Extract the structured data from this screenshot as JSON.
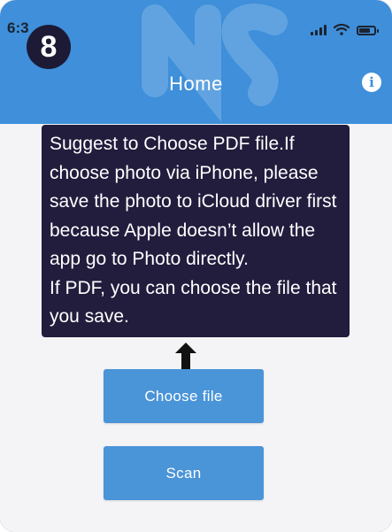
{
  "status_bar": {
    "time": "6:3",
    "icons": [
      "signal-icon",
      "wifi-icon",
      "battery-icon"
    ]
  },
  "step_badge": "8",
  "nav": {
    "title": "Home",
    "info_icon": "i"
  },
  "tooltip": {
    "paragraph_1": "Suggest to Choose PDF file.If choose photo via iPhone, please save the photo to iCloud driver first because Apple doesn’t allow the app go to Photo directly.",
    "paragraph_2": "If PDF, you can choose the file that you save."
  },
  "buttons": {
    "choose_file": "Choose file",
    "scan": "Scan"
  },
  "colors": {
    "header": "#3f8fda",
    "button": "#4a94d8",
    "tooltip": "#221c3d",
    "badge": "#1d1a36",
    "background": "#f4f4f6"
  }
}
